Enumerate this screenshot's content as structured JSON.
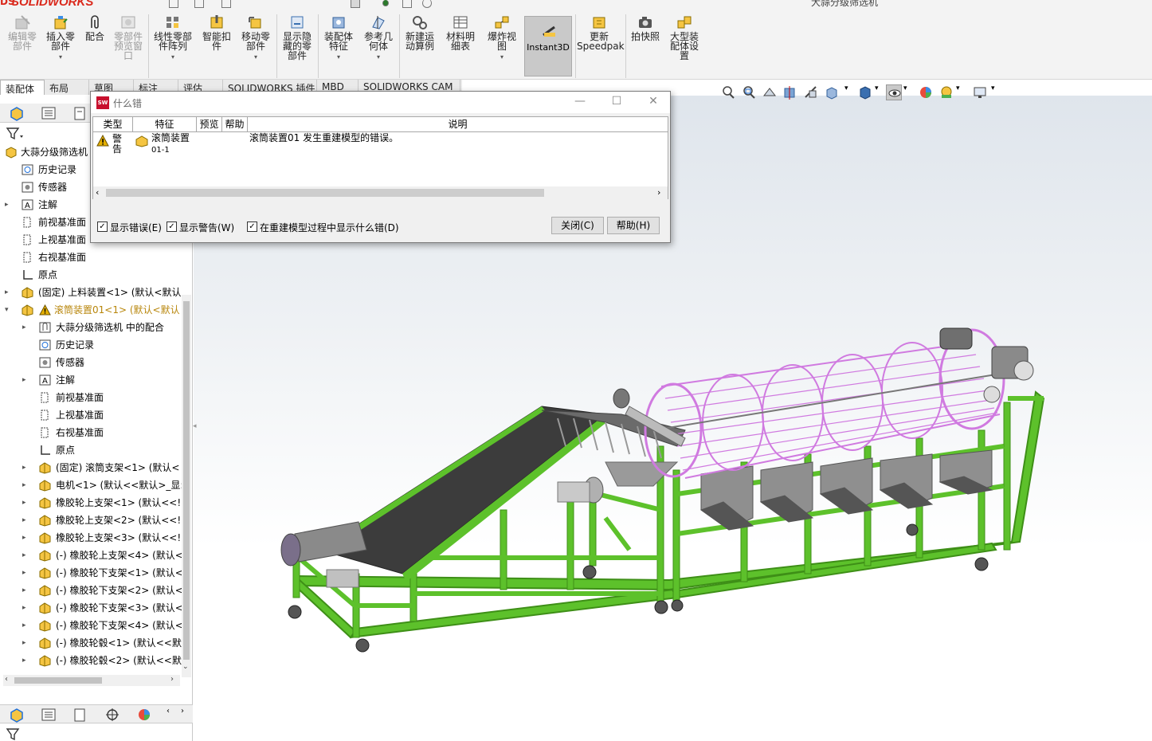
{
  "app": {
    "logo": "SOLIDWORKS",
    "title": "大蒜分级筛选机"
  },
  "ribbon": {
    "buttons": [
      {
        "label": "编辑零\n部件",
        "disabled": true
      },
      {
        "label": "插入零\n部件"
      },
      {
        "label": "配合"
      },
      {
        "label": "零部件\n预览窗\n口",
        "disabled": true
      },
      {
        "label": "线性零部\n件阵列"
      },
      {
        "label": "智能扣\n件"
      },
      {
        "label": "移动零\n部件"
      },
      {
        "label": "显示隐\n藏的零\n部件"
      },
      {
        "label": "装配体\n特征"
      },
      {
        "label": "参考几\n何体"
      },
      {
        "label": "新建运\n动算例"
      },
      {
        "label": "材料明\n细表"
      },
      {
        "label": "爆炸视\n图"
      },
      {
        "label": "Instant3D"
      },
      {
        "label": "更新\nSpeedpak"
      },
      {
        "label": "拍快照"
      },
      {
        "label": "大型装\n配体设\n置"
      }
    ]
  },
  "tabs": [
    "装配体",
    "布局",
    "草图",
    "标注",
    "评估",
    "SOLIDWORKS 插件",
    "MBD",
    "SOLIDWORKS CAM"
  ],
  "tree": {
    "root": "大蒜分级筛选机",
    "items": [
      {
        "label": "历史记录",
        "indent": 1
      },
      {
        "label": "传感器",
        "indent": 1
      },
      {
        "label": "注解",
        "indent": 1,
        "expander": "▸"
      },
      {
        "label": "前视基准面",
        "indent": 1
      },
      {
        "label": "上视基准面",
        "indent": 1
      },
      {
        "label": "右视基准面",
        "indent": 1
      },
      {
        "label": "原点",
        "indent": 1
      },
      {
        "label": "(固定) 上料装置<1> (默认<默认",
        "indent": 1,
        "expander": "▸"
      },
      {
        "label": "滚筒装置01<1> (默认<默认",
        "indent": 1,
        "expander": "▾",
        "warn": true
      },
      {
        "label": "大蒜分级筛选机 中的配合",
        "indent": 2,
        "expander": "▸"
      },
      {
        "label": "历史记录",
        "indent": 2
      },
      {
        "label": "传感器",
        "indent": 2
      },
      {
        "label": "注解",
        "indent": 2,
        "expander": "▸"
      },
      {
        "label": "前视基准面",
        "indent": 2
      },
      {
        "label": "上视基准面",
        "indent": 2
      },
      {
        "label": "右视基准面",
        "indent": 2
      },
      {
        "label": "原点",
        "indent": 2
      },
      {
        "label": "(固定) 滚筒支架<1> (默认<",
        "indent": 2,
        "expander": "▸"
      },
      {
        "label": "电机<1> (默认<<默认>_显:",
        "indent": 2,
        "expander": "▸"
      },
      {
        "label": "橡胶轮上支架<1> (默认<<!",
        "indent": 2,
        "expander": "▸"
      },
      {
        "label": "橡胶轮上支架<2> (默认<<!",
        "indent": 2,
        "expander": "▸"
      },
      {
        "label": "橡胶轮上支架<3> (默认<<!",
        "indent": 2,
        "expander": "▸"
      },
      {
        "label": "(-) 橡胶轮上支架<4> (默认<",
        "indent": 2,
        "expander": "▸"
      },
      {
        "label": "(-) 橡胶轮下支架<1> (默认<",
        "indent": 2,
        "expander": "▸"
      },
      {
        "label": "(-) 橡胶轮下支架<2> (默认<",
        "indent": 2,
        "expander": "▸"
      },
      {
        "label": "(-) 橡胶轮下支架<3> (默认<",
        "indent": 2,
        "expander": "▸"
      },
      {
        "label": "(-) 橡胶轮下支架<4> (默认<",
        "indent": 2,
        "expander": "▸"
      },
      {
        "label": "(-) 橡胶轮毂<1> (默认<<默",
        "indent": 2,
        "expander": "▸"
      },
      {
        "label": "(-) 橡胶轮毂<2> (默认<<默",
        "indent": 2,
        "expander": "▸"
      }
    ]
  },
  "dialog": {
    "title": "什么错",
    "headers": {
      "type": "类型",
      "feature": "特征",
      "preview": "预览",
      "help": "帮助",
      "description": "说明"
    },
    "row": {
      "type": "警告",
      "feature_line1": "滚筒装置",
      "feature_line2": "01-1",
      "description": "滚筒装置01 发生重建模型的错误。"
    },
    "checkboxes": {
      "show_errors": "显示错误(E)",
      "show_warnings": "显示警告(W)",
      "show_during_rebuild": "在重建模型过程中显示什么错(D)"
    },
    "buttons": {
      "close": "关闭(C)",
      "help": "帮助(H)"
    }
  },
  "colors": {
    "frame_green": "#5dc12b",
    "drum_pink": "#d07ae0",
    "belt_dark": "#3c3c3c",
    "warning": "#e5b000"
  }
}
